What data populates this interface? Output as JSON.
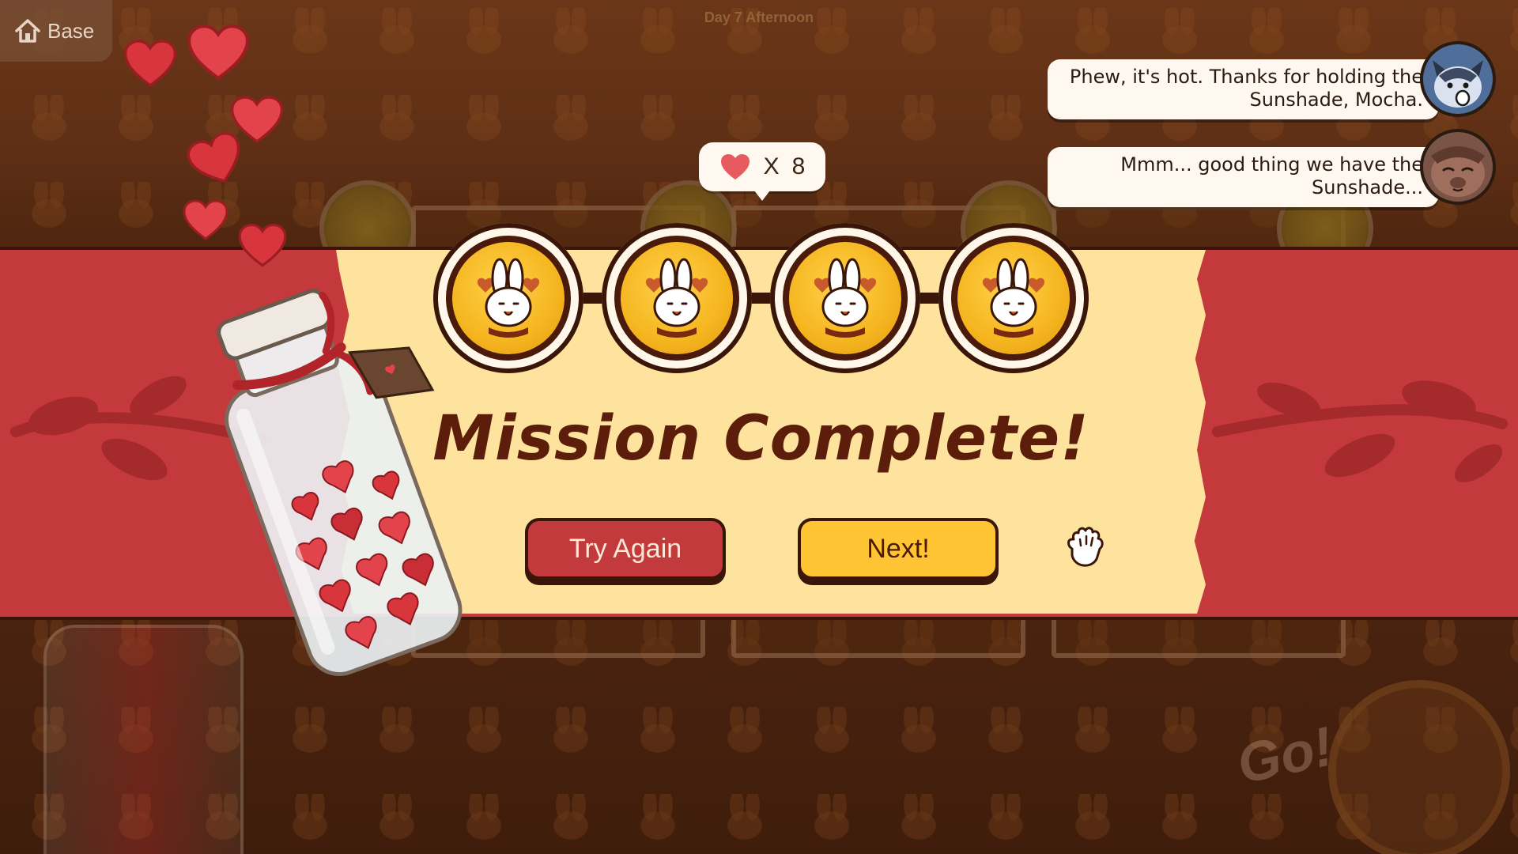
{
  "hud": {
    "base_label": "Base",
    "day_label": "Day 7 Afternoon"
  },
  "chat": [
    {
      "text": "Phew, it's hot. Thanks for holding the Sunshade, Mocha.",
      "speaker_icon": "wolf-avatar"
    },
    {
      "text": "Mmm... good thing we have the Sunshade...",
      "speaker_icon": "dog-avatar"
    }
  ],
  "reward": {
    "multiplier": "X",
    "count": "8",
    "icon": "heart-icon"
  },
  "medals": {
    "earned": 4,
    "icon": "bunny-peace-medal-icon"
  },
  "result": {
    "title": "Mission Complete!",
    "try_again_label": "Try Again",
    "next_label": "Next!"
  },
  "background": {
    "go_label": "Go!"
  },
  "colors": {
    "band_red": "#c4393b",
    "paper_cream": "#fde39d",
    "title_brown": "#5c1e0a",
    "next_yellow": "#ffc433",
    "medal_gold": "#f5b51f"
  }
}
